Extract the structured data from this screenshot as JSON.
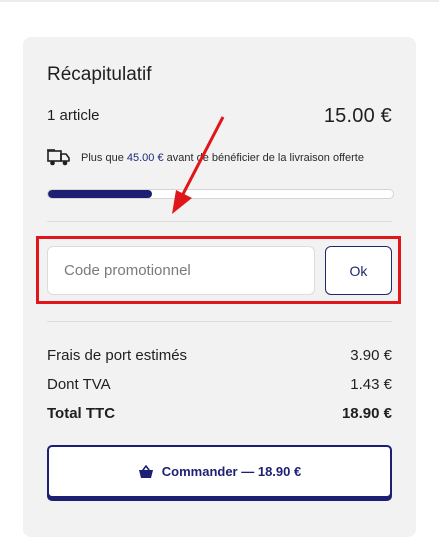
{
  "summary": {
    "title": "Récapitulatif",
    "article_count": "1 article",
    "article_price": "15.00 €"
  },
  "shipping": {
    "icon": "truck-icon",
    "text_before": "Plus que ",
    "amount": "45.00 €",
    "text_after": " avant de bénéficier de la livraison offerte",
    "progress_fraction": 0.3
  },
  "promo": {
    "placeholder": "Code promotionnel",
    "value": "",
    "ok_label": "Ok"
  },
  "totals": {
    "shipping_label": "Frais de port estimés",
    "shipping_value": "3.90 €",
    "tva_label": "Dont TVA",
    "tva_value": "1.43 €",
    "total_label": "Total TTC",
    "total_value": "18.90 €"
  },
  "checkout": {
    "icon": "basket-icon",
    "label": "Commander — 18.90 €"
  },
  "colors": {
    "accent": "#1d1f73",
    "highlight": "#e0161b",
    "card_background": "#f2f2f2"
  }
}
